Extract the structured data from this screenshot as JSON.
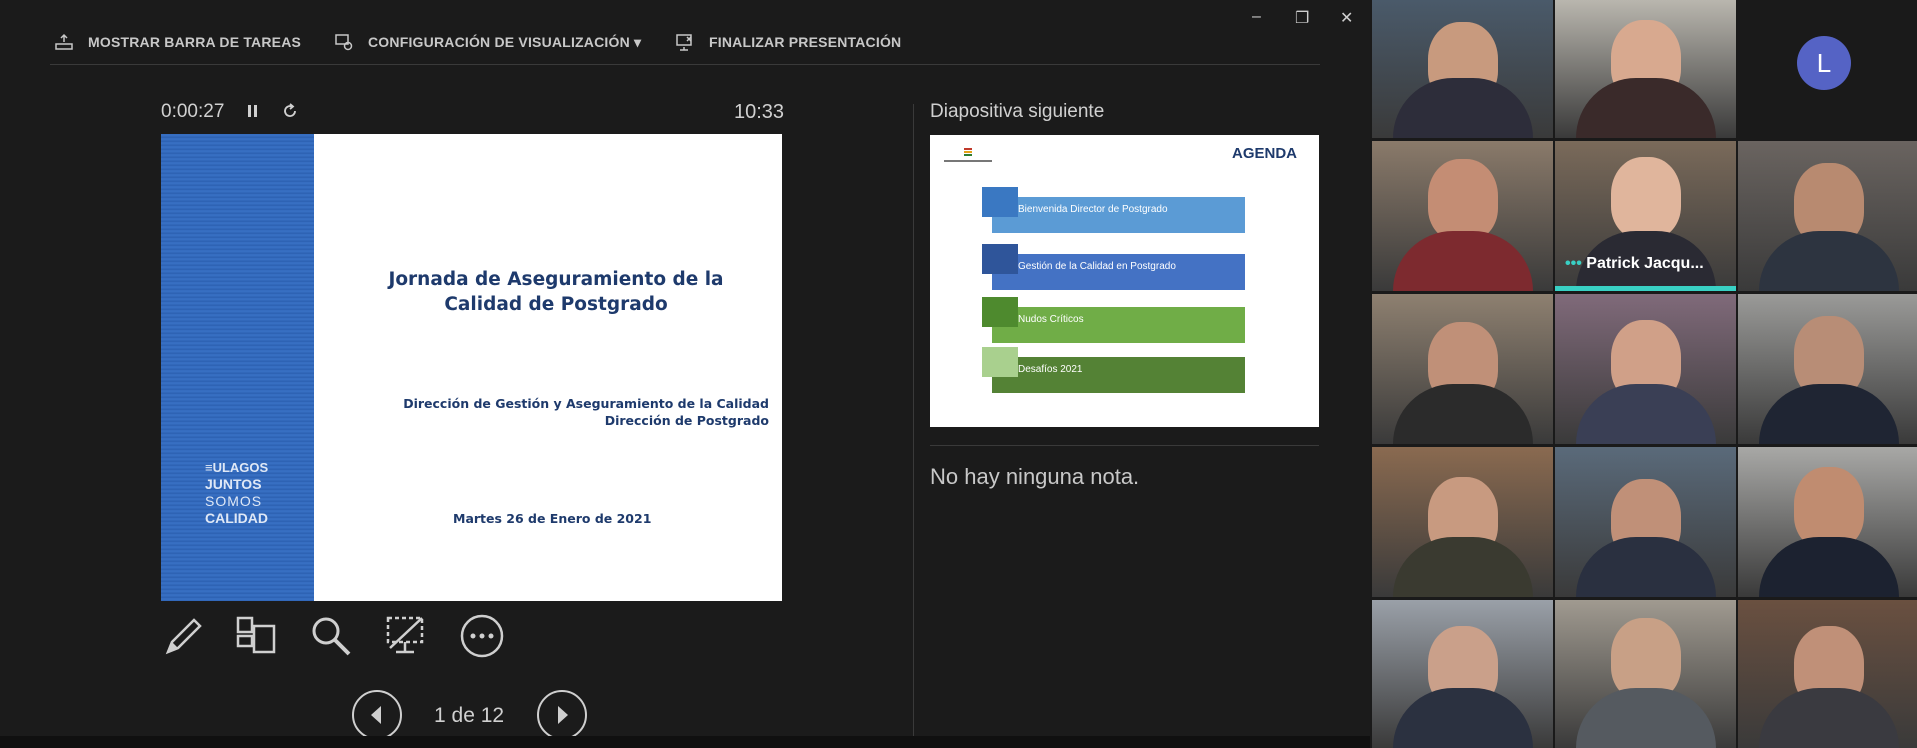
{
  "toolbar": {
    "show_taskbar": "MOSTRAR BARRA DE TAREAS",
    "display_settings": "CONFIGURACIÓN DE VISUALIZACIÓN ▾",
    "end_presentation": "FINALIZAR PRESENTACIÓN"
  },
  "window": {
    "minimize": "–",
    "restore": "❐",
    "close": "✕"
  },
  "timer": {
    "elapsed": "0:00:27",
    "clock": "10:33"
  },
  "current_slide": {
    "title_line1": "Jornada de Aseguramiento de la",
    "title_line2": "Calidad de Postgrado",
    "subtitle_line1": "Dirección de Gestión y Aseguramiento de la Calidad",
    "subtitle_line2": "Dirección de Postgrado",
    "date": "Martes 26 de Enero de 2021",
    "band_logo": [
      "≡ULAGOS",
      "JUNTOS",
      "SOMOS",
      "CALIDAD"
    ]
  },
  "navigation": {
    "page_label": "1 de 12"
  },
  "next_slide": {
    "label": "Diapositiva siguiente",
    "title": "AGENDA",
    "items": [
      {
        "text": "Bienvenida Director de Postgrado",
        "color": "#5b9bd5",
        "tab": "#3a78c2"
      },
      {
        "text": "Gestión de la Calidad en Postgrado",
        "color": "#4472c4",
        "tab": "#2f559a"
      },
      {
        "text": "Nudos Críticos",
        "color": "#70ad47",
        "tab": "#4e8a2e"
      },
      {
        "text": "Desafíos 2021",
        "color": "#548235",
        "tab": "#a9d08e"
      }
    ]
  },
  "notes": {
    "text": "No hay ninguna nota."
  },
  "participants": {
    "speaker_name": "Patrick Jacqu...",
    "avatar_initial": "L"
  },
  "colors": {
    "speaking_border": "#39d0c4",
    "avatar_bg": "#5563c5"
  }
}
